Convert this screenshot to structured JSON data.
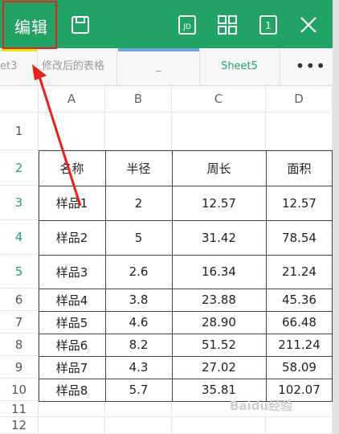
{
  "toolbar": {
    "edit_label": "编辑",
    "icons": [
      "save-icon",
      "jd-icon",
      "grid-icon",
      "one-window-icon",
      "close-icon"
    ],
    "jd_text": "JD",
    "window_count": "1",
    "accent_color": "#21a366"
  },
  "tabs": [
    {
      "label": "et3"
    },
    {
      "label": "修改后的表格"
    },
    {
      "label": "_"
    },
    {
      "label": "Sheet5",
      "active": true
    }
  ],
  "more_label": "•••",
  "columns": [
    "A",
    "B",
    "C",
    "D"
  ],
  "rows": [
    "1",
    "2",
    "3",
    "4",
    "5",
    "6",
    "7",
    "8",
    "9",
    "10",
    "11",
    "12"
  ],
  "table": {
    "header": [
      "名称",
      "半径",
      "周长",
      "面积"
    ],
    "body": [
      [
        "样品1",
        "2",
        "12.57",
        "12.57"
      ],
      [
        "样品2",
        "5",
        "31.42",
        "78.54"
      ],
      [
        "样品3",
        "2.6",
        "16.34",
        "21.24"
      ],
      [
        "样品4",
        "3.8",
        "23.88",
        "45.36"
      ],
      [
        "样品5",
        "4.6",
        "28.90",
        "66.48"
      ],
      [
        "样品6",
        "8.2",
        "51.52",
        "211.24"
      ],
      [
        "样品7",
        "4.3",
        "27.02",
        "58.09"
      ],
      [
        "样品8",
        "5.7",
        "35.81",
        "102.07"
      ]
    ]
  },
  "watermark": "Baidu经验"
}
